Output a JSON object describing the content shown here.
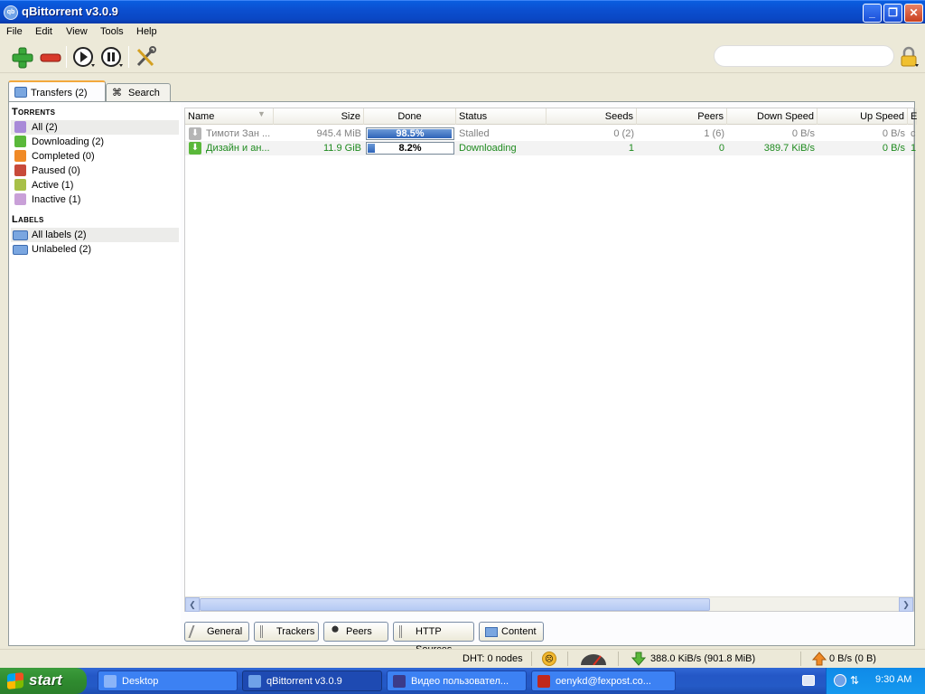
{
  "window": {
    "title": "qBittorrent v3.0.9",
    "icon_text": "qb"
  },
  "menu": [
    "File",
    "Edit",
    "View",
    "Tools",
    "Help"
  ],
  "search": {
    "placeholder": ""
  },
  "tabs": [
    {
      "label": "Transfers (2)"
    },
    {
      "label": "Search"
    }
  ],
  "sidebar": {
    "torrents_heading": "Torrents",
    "filters": [
      {
        "label": "All (2)",
        "icon": "all-icon",
        "color": "#a88ad8"
      },
      {
        "label": "Downloading (2)",
        "icon": "download-arrow-icon",
        "color": "#5ab83a"
      },
      {
        "label": "Completed (0)",
        "icon": "upload-arrow-icon",
        "color": "#f08a26"
      },
      {
        "label": "Paused (0)",
        "icon": "pause-icon",
        "color": "#c84a3a"
      },
      {
        "label": "Active (1)",
        "icon": "active-play-icon",
        "color": "#a8c048"
      },
      {
        "label": "Inactive (1)",
        "icon": "inactive-icon",
        "color": "#c9a0d8"
      }
    ],
    "labels_heading": "Labels",
    "labels": [
      {
        "label": "All labels (2)",
        "icon": "folder-icon"
      },
      {
        "label": "Unlabeled (2)",
        "icon": "folder-icon"
      }
    ]
  },
  "columns": [
    "Name",
    "Size",
    "Done",
    "Status",
    "Seeds",
    "Peers",
    "Down Speed",
    "Up Speed",
    "E"
  ],
  "torrents": [
    {
      "name": "Тимоти Зан ...",
      "size": "945.4 MiB",
      "done": "98.5%",
      "progress": 0.985,
      "status": "Stalled",
      "seeds": "0 (2)",
      "peers": "1 (6)",
      "down": "0 B/s",
      "up": "0 B/s",
      "extra": "c",
      "text_color": "#808080",
      "icon_color": "#b5b5b5"
    },
    {
      "name": "Дизайн и ан...",
      "size": "11.9 GiB",
      "done": "8.2%",
      "progress": 0.082,
      "status": "Downloading",
      "seeds": "1",
      "peers": "0",
      "down": "389.7 KiB/s",
      "up": "0 B/s",
      "extra": "1",
      "text_color": "#1e8a1e",
      "icon_color": "#5ab83a"
    }
  ],
  "bottom_tabs": [
    {
      "label": "General",
      "icon": "general-icon"
    },
    {
      "label": "Trackers",
      "icon": "trackers-icon"
    },
    {
      "label": "Peers",
      "icon": "peers-icon"
    },
    {
      "label": "HTTP Sources",
      "icon": "http-sources-icon"
    },
    {
      "label": "Content",
      "icon": "content-folder-icon"
    }
  ],
  "status": {
    "dht": "DHT: 0 nodes",
    "down": "388.0 KiB/s (901.8 MiB)",
    "up": "0 B/s (0 B)"
  },
  "taskbar": {
    "start": "start",
    "tasks": [
      {
        "label": "Desktop",
        "icon": "desktop-icon",
        "active": false
      },
      {
        "label": "qBittorrent v3.0.9",
        "icon": "qbittorrent-icon",
        "active": true
      },
      {
        "label": "Видео пользовател...",
        "icon": "video-icon",
        "active": false
      },
      {
        "label": "oenykd@fexpost.co...",
        "icon": "filezilla-icon",
        "active": false
      }
    ],
    "clock": "9:30 AM"
  }
}
